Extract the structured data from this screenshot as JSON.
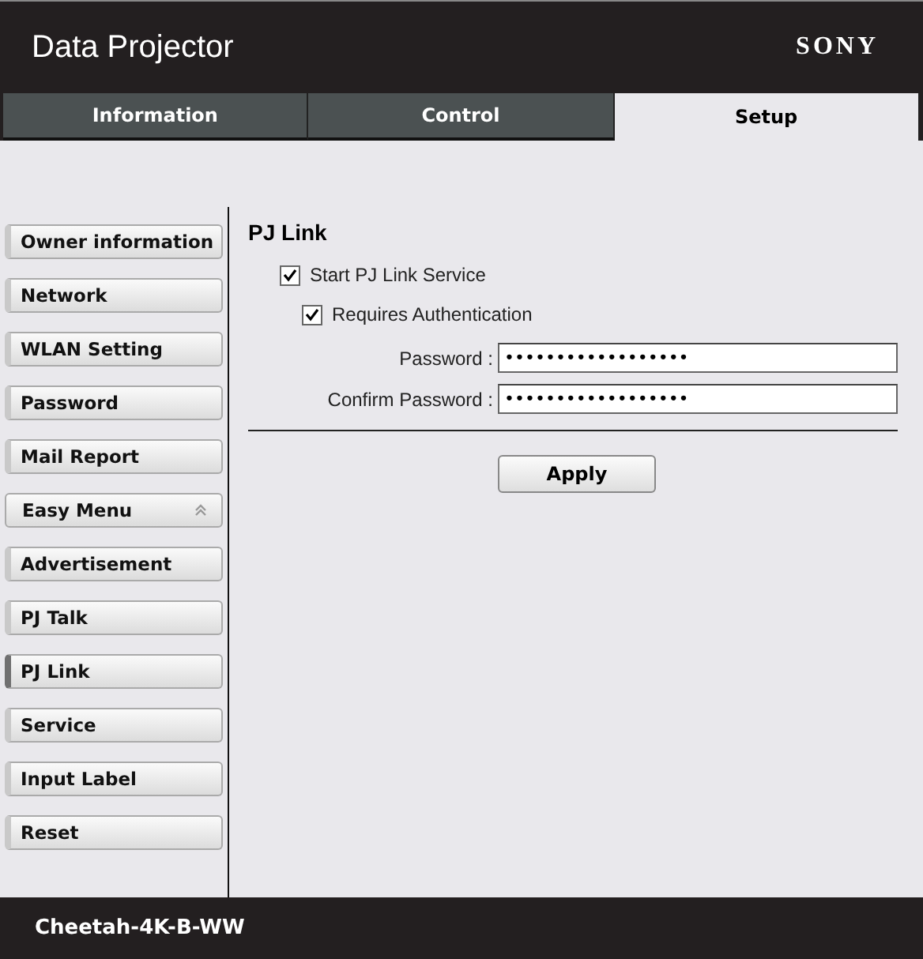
{
  "header": {
    "title": "Data Projector",
    "brand": "SONY"
  },
  "tabs": [
    {
      "label": "Information",
      "selected": false
    },
    {
      "label": "Control",
      "selected": false
    },
    {
      "label": "Setup",
      "selected": true
    }
  ],
  "sidebar": {
    "items": [
      {
        "label": "Owner information",
        "kind": "item",
        "selected": false
      },
      {
        "label": "Network",
        "kind": "item",
        "selected": false
      },
      {
        "label": "WLAN Setting",
        "kind": "item",
        "selected": false
      },
      {
        "label": "Password",
        "kind": "item",
        "selected": false
      },
      {
        "label": "Mail Report",
        "kind": "item",
        "selected": false
      },
      {
        "label": "Easy Menu",
        "kind": "group",
        "selected": false,
        "expanded": true
      },
      {
        "label": "Advertisement",
        "kind": "item",
        "selected": false
      },
      {
        "label": "PJ Talk",
        "kind": "item",
        "selected": false
      },
      {
        "label": "PJ Link",
        "kind": "item",
        "selected": true
      },
      {
        "label": "Service",
        "kind": "item",
        "selected": false
      },
      {
        "label": "Input Label",
        "kind": "item",
        "selected": false
      },
      {
        "label": "Reset",
        "kind": "item",
        "selected": false
      }
    ]
  },
  "panel": {
    "title": "PJ Link",
    "checkboxes": [
      {
        "label": "Start PJ Link Service",
        "checked": true
      },
      {
        "label": "Requires Authentication",
        "checked": true
      }
    ],
    "fields": [
      {
        "label": "Password :",
        "value": "••••••••••••••••••"
      },
      {
        "label": "Confirm Password :",
        "value": "••••••••••••••••••"
      }
    ],
    "button": "Apply"
  },
  "footer": {
    "model": "Cheetah-4K-B-WW"
  }
}
